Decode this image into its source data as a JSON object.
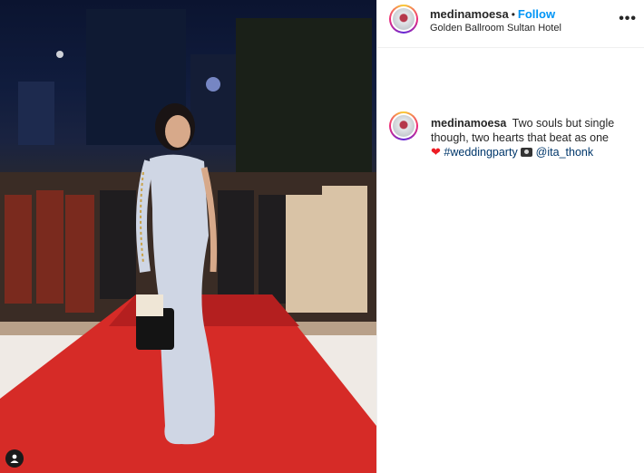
{
  "post": {
    "username": "medinamoesa",
    "separator": "•",
    "follow_label": "Follow",
    "location": "Golden Ballroom Sultan Hotel",
    "more_icon": "more-horizontal-icon"
  },
  "caption": {
    "author": "medinamoesa",
    "text": "Two souls but single though, two hearts that beat as one",
    "heart_emoji": "❤",
    "hashtag": "#weddingparty",
    "camera_emoji": "camera-icon",
    "mention": "@ita_thonk"
  },
  "photo": {
    "user_tag_icon": "person-tag-icon",
    "colors": {
      "carpet": "#d62b27",
      "sky": "#0b1430",
      "dress": "#cfd6e4"
    }
  }
}
